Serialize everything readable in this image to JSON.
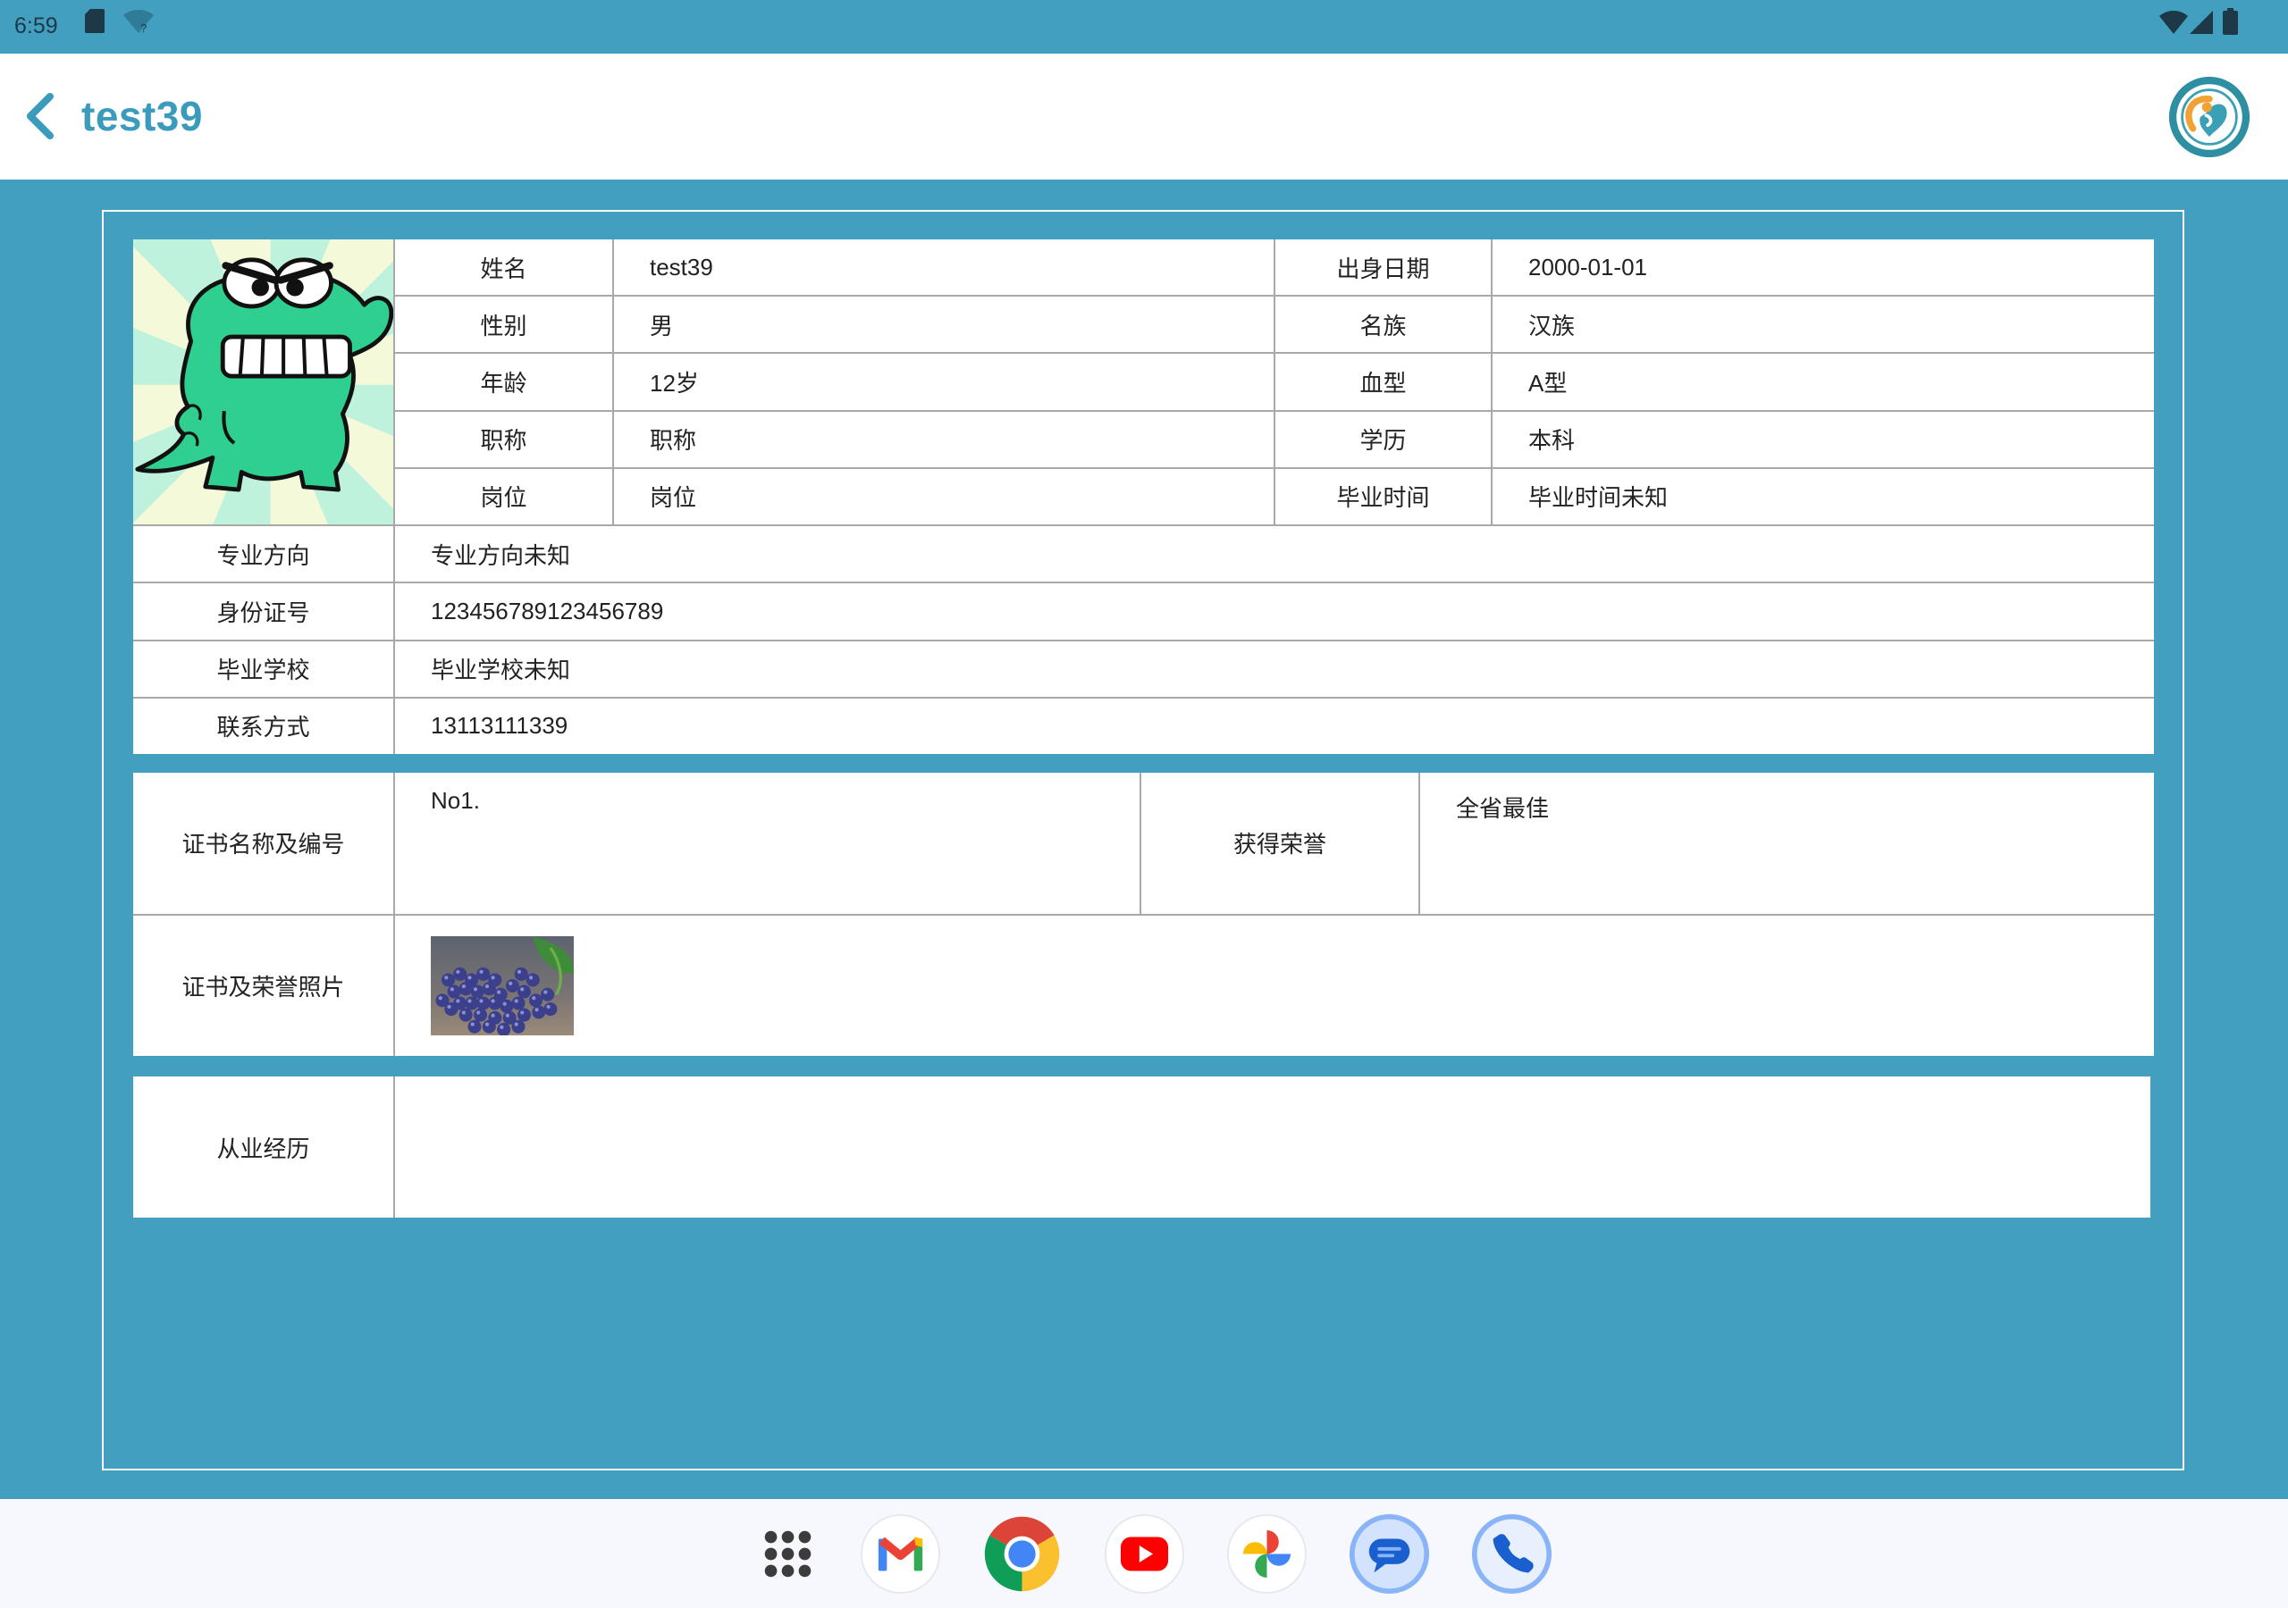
{
  "status_bar": {
    "time": "6:59",
    "icons_left": [
      "sd-card-icon",
      "wifi-question-icon"
    ],
    "icons_right": [
      "wifi-icon",
      "signal-icon",
      "battery-icon"
    ]
  },
  "app_bar": {
    "back_icon": "chevron-left-icon",
    "title": "test39",
    "logo_icon": "organization-logo-icon"
  },
  "profile": {
    "rows": [
      {
        "label": "姓名",
        "value": "test39",
        "label2": "出身日期",
        "value2": "2000-01-01"
      },
      {
        "label": "性别",
        "value": "男",
        "label2": "名族",
        "value2": "汉族"
      },
      {
        "label": "年龄",
        "value": "12岁",
        "label2": "血型",
        "value2": "A型"
      },
      {
        "label": "职称",
        "value": "职称",
        "label2": "学历",
        "value2": "本科"
      },
      {
        "label": "岗位",
        "value": "岗位",
        "label2": "毕业时间",
        "value2": "毕业时间未知"
      }
    ],
    "full_rows": [
      {
        "label": "专业方向",
        "value": "专业方向未知"
      },
      {
        "label": "身份证号",
        "value": "123456789123456789"
      },
      {
        "label": "毕业学校",
        "value": "毕业学校未知"
      },
      {
        "label": "联系方式",
        "value": "13113111339"
      }
    ]
  },
  "certificates": {
    "name_label": "证书名称及编号",
    "name_value": "No1.",
    "honor_label": "获得荣誉",
    "honor_value": "全省最佳",
    "photo_label": "证书及荣誉照片"
  },
  "experience": {
    "label": "从业经历",
    "value": ""
  },
  "dock": [
    {
      "icon": "app-drawer-icon"
    },
    {
      "icon": "gmail-icon"
    },
    {
      "icon": "chrome-icon"
    },
    {
      "icon": "youtube-icon"
    },
    {
      "icon": "photos-icon"
    },
    {
      "icon": "messages-icon"
    },
    {
      "icon": "phone-icon"
    }
  ],
  "colors": {
    "primary": "#429fc0",
    "title": "#3a9bbd",
    "grid_line": "#a9a9a9",
    "dock_bg": "#f6f8fd"
  }
}
